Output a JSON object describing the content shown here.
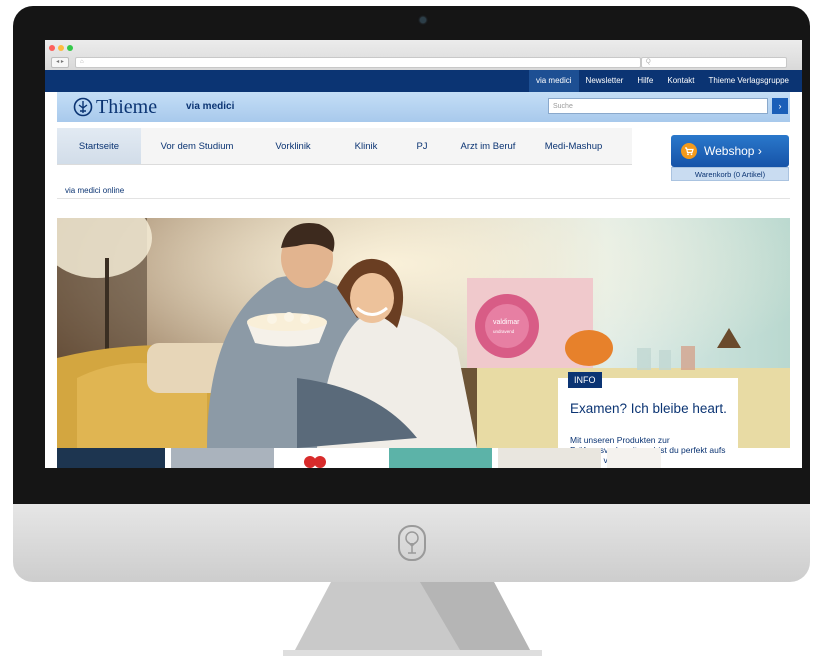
{
  "browser": {
    "dot_colors": [
      "#fc605c",
      "#fdbc40",
      "#34c84a"
    ],
    "nav_glyph": "◂ ▸",
    "url_glyph": "⌂",
    "search_glyph": "Q"
  },
  "top_nav": {
    "links": [
      "via medici",
      "Newsletter",
      "Hilfe",
      "Kontakt",
      "Thieme Verlagsgruppe"
    ],
    "active_index": 0
  },
  "header": {
    "logo_text": "Thieme",
    "brand": "via medici",
    "search_placeholder": "Suche",
    "search_button": "›"
  },
  "main_nav": {
    "items": [
      "Startseite",
      "Vor dem Studium",
      "Vorklinik",
      "Klinik",
      "PJ",
      "Arzt im Beruf",
      "Medi-Mashup"
    ],
    "active_index": 0
  },
  "webshop": {
    "label": "Webshop ›",
    "cart": "Warenkorb (0 Artikel)"
  },
  "breadcrumb": "via medici online",
  "hero": {
    "poster_text": "valdimar",
    "poster_subtext": "undravend"
  },
  "info": {
    "badge": "INFO",
    "title": "Examen? Ich bleibe heart.",
    "body": "Mit unseren Produkten zur Prüfungsvorbereitung bist du perfekt aufs Examen vorbereitet."
  },
  "colors": {
    "brand_dark": "#0b3473",
    "header_light": "#b9d5f2",
    "accent_orange": "#f39a1c"
  }
}
